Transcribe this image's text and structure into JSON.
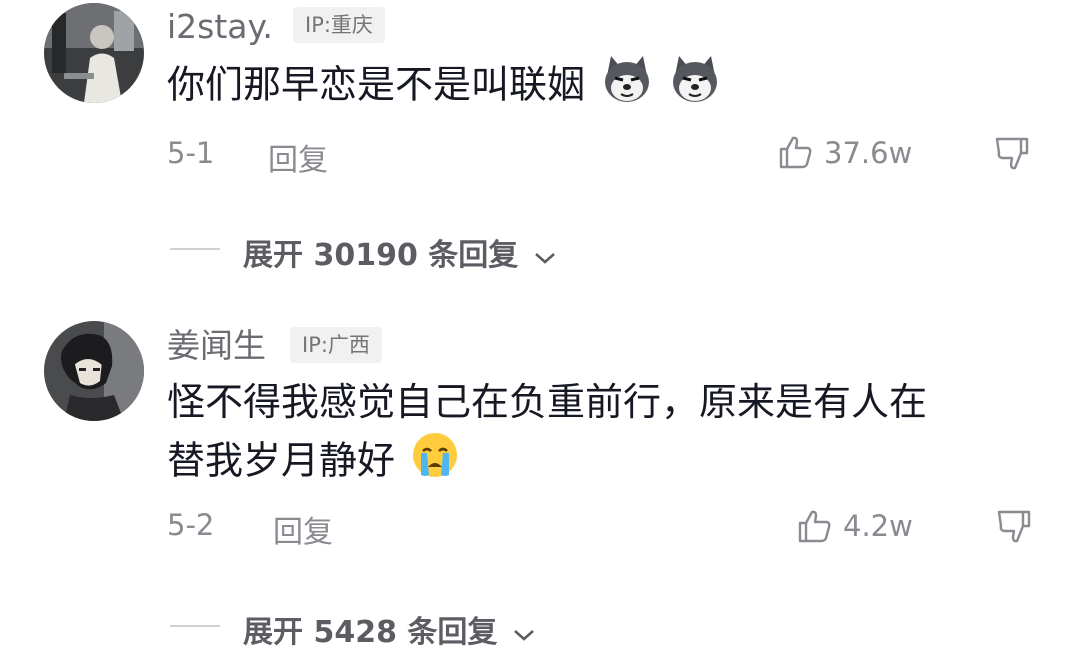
{
  "comments": [
    {
      "username": "i2stay.",
      "ip": "IP:重庆",
      "text_lines": [
        "你们那早恋是不是叫联姻"
      ],
      "emojis": [
        "husky-dog-emoji",
        "husky-dog-emoji"
      ],
      "date": "5-1",
      "reply_label": "回复",
      "likes": "37.6w",
      "expand_label": "展开 30190 条回复"
    },
    {
      "username": "姜闻生",
      "ip": "IP:广西",
      "text_lines": [
        "怪不得我感觉自己在负重前行，原来是有人在",
        "替我岁月静好"
      ],
      "emojis": [
        "crying-face-emoji"
      ],
      "date": "5-2",
      "reply_label": "回复",
      "likes": "4.2w",
      "expand_label": "展开 5428 条回复"
    }
  ],
  "icons": {
    "like": "thumbs-up-icon",
    "dislike": "thumbs-down-icon",
    "expand": "chevron-down-icon"
  },
  "colors": {
    "text": "#161823",
    "secondary": "#8a8b91",
    "ip_badge_bg": "#f1f1f2"
  }
}
